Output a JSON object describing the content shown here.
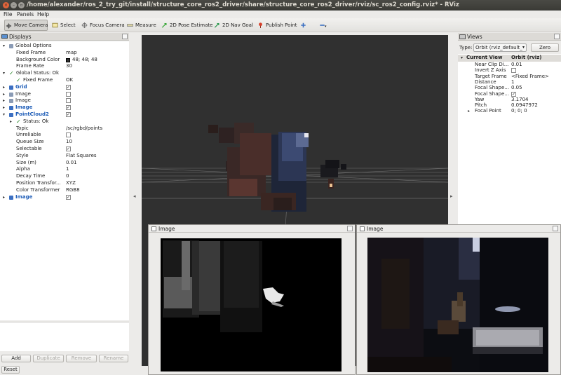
{
  "window": {
    "title": "/home/alexander/ros_2_try_git/install/structure_core_ros2_driver/share/structure_core_ros2_driver/rviz/sc_ros2_config.rviz* - RViz"
  },
  "menu": [
    "File",
    "Panels",
    "Help"
  ],
  "toolbar": {
    "tools": [
      {
        "label": "Move Camera",
        "icon": "move-camera-icon"
      },
      {
        "label": "Select",
        "icon": "select-icon"
      },
      {
        "label": "Focus Camera",
        "icon": "focus-camera-icon"
      },
      {
        "label": "Measure",
        "icon": "measure-icon"
      },
      {
        "label": "2D Pose Estimate",
        "icon": "pose-arrow-icon"
      },
      {
        "label": "2D Nav Goal",
        "icon": "nav-goal-icon"
      },
      {
        "label": "Publish Point",
        "icon": "pin-icon"
      }
    ],
    "plus_icon": "plus-icon",
    "minus_icon": "minus-icon"
  },
  "displays": {
    "title": "Displays",
    "rows": [
      {
        "indent": 0,
        "arrow": "▾",
        "label": "Global Options",
        "icon": "gear-icon",
        "value": ""
      },
      {
        "indent": 1,
        "arrow": "",
        "label": "Fixed Frame",
        "value": "map"
      },
      {
        "indent": 1,
        "arrow": "",
        "label": "Background Color",
        "value": "48; 48; 48",
        "swatch": "#303030"
      },
      {
        "indent": 1,
        "arrow": "",
        "label": "Frame Rate",
        "value": "30"
      },
      {
        "indent": 0,
        "arrow": "▾",
        "label": "Global Status: Ok",
        "ok": true,
        "value": ""
      },
      {
        "indent": 1,
        "arrow": "",
        "label": "Fixed Frame",
        "ok": true,
        "value": "OK"
      },
      {
        "indent": 0,
        "arrow": "▸",
        "label": "Grid",
        "blue": true,
        "checked": true
      },
      {
        "indent": 0,
        "arrow": "▸",
        "label": "Image",
        "checked": false
      },
      {
        "indent": 0,
        "arrow": "▸",
        "label": "Image",
        "checked": false
      },
      {
        "indent": 0,
        "arrow": "▸",
        "label": "Image",
        "blue": true,
        "checked": true
      },
      {
        "indent": 0,
        "arrow": "▾",
        "label": "PointCloud2",
        "blue": true,
        "checked": true
      },
      {
        "indent": 1,
        "arrow": "▸",
        "label": "Status: Ok",
        "ok": true,
        "value": ""
      },
      {
        "indent": 1,
        "arrow": "",
        "label": "Topic",
        "value": "/sc/rgbd/points"
      },
      {
        "indent": 1,
        "arrow": "",
        "label": "Unreliable",
        "checked": false
      },
      {
        "indent": 1,
        "arrow": "",
        "label": "Queue Size",
        "value": "10"
      },
      {
        "indent": 1,
        "arrow": "",
        "label": "Selectable",
        "checked": true
      },
      {
        "indent": 1,
        "arrow": "",
        "label": "Style",
        "value": "Flat Squares"
      },
      {
        "indent": 1,
        "arrow": "",
        "label": "Size (m)",
        "value": "0.01"
      },
      {
        "indent": 1,
        "arrow": "",
        "label": "Alpha",
        "value": "1"
      },
      {
        "indent": 1,
        "arrow": "",
        "label": "Decay Time",
        "value": "0"
      },
      {
        "indent": 1,
        "arrow": "",
        "label": "Position Transfor...",
        "value": "XYZ"
      },
      {
        "indent": 1,
        "arrow": "",
        "label": "Color Transformer",
        "value": "RGB8"
      },
      {
        "indent": 0,
        "arrow": "▸",
        "label": "Image",
        "blue": true,
        "checked": true
      }
    ],
    "buttons": {
      "add": "Add",
      "duplicate": "Duplicate",
      "remove": "Remove",
      "rename": "Rename"
    },
    "reset": "Reset"
  },
  "views": {
    "title": "Views",
    "type_label": "Type:",
    "type_value": "Orbit (rviz_default_",
    "zero": "Zero",
    "current_label": "Current View",
    "current_value": "Orbit (rviz)",
    "props": [
      {
        "label": "Near Clip Di...",
        "value": "0.01"
      },
      {
        "label": "Invert Z Axis",
        "checked": false
      },
      {
        "label": "Target Frame",
        "value": "<Fixed Frame>"
      },
      {
        "label": "Distance",
        "value": "1"
      },
      {
        "label": "Focal Shape...",
        "value": "0.05"
      },
      {
        "label": "Focal Shape...",
        "checked": true
      },
      {
        "label": "Yaw",
        "value": "3.1704"
      },
      {
        "label": "Pitch",
        "value": "0.0947972"
      },
      {
        "label": "Focal Point",
        "value": "0; 0; 0",
        "arrow": "▸"
      }
    ]
  },
  "image_windows": [
    {
      "title": "Image"
    },
    {
      "title": "Image"
    }
  ],
  "colors": {
    "background": "#303030",
    "accent": "#1d5cb7",
    "ok": "#2c8a2c"
  }
}
